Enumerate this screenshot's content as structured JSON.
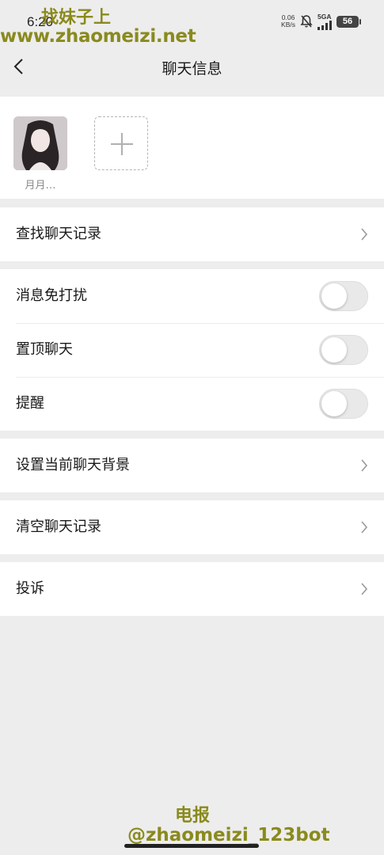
{
  "status_bar": {
    "time": "6:20",
    "net_speed_value": "0.06",
    "net_speed_unit": "KB/s",
    "network": "5GA",
    "battery": "56",
    "icons": [
      "bell-off-icon",
      "signal-icon",
      "battery-icon"
    ]
  },
  "watermark": {
    "top_line1": "找妹子上",
    "top_line2": "www.zhaomeizi.net",
    "bottom_line1": "电报",
    "bottom_line2": "@zhaomeizi_123bot"
  },
  "nav": {
    "title": "聊天信息",
    "back_icon": "chevron-left-icon"
  },
  "members": [
    {
      "name": "月月…"
    }
  ],
  "add_member_icon": "plus-icon",
  "list": {
    "search_history": "查找聊天记录",
    "mute": {
      "label": "消息免打扰",
      "on": false
    },
    "pin": {
      "label": "置顶聊天",
      "on": false
    },
    "remind": {
      "label": "提醒",
      "on": false
    },
    "set_background": "设置当前聊天背景",
    "clear_history": "清空聊天记录",
    "report": "投诉"
  },
  "colors": {
    "page_bg": "#ededed",
    "card_bg": "#ffffff",
    "watermark": "#8a8a1e",
    "toggle_off": "#e9e9e9"
  }
}
